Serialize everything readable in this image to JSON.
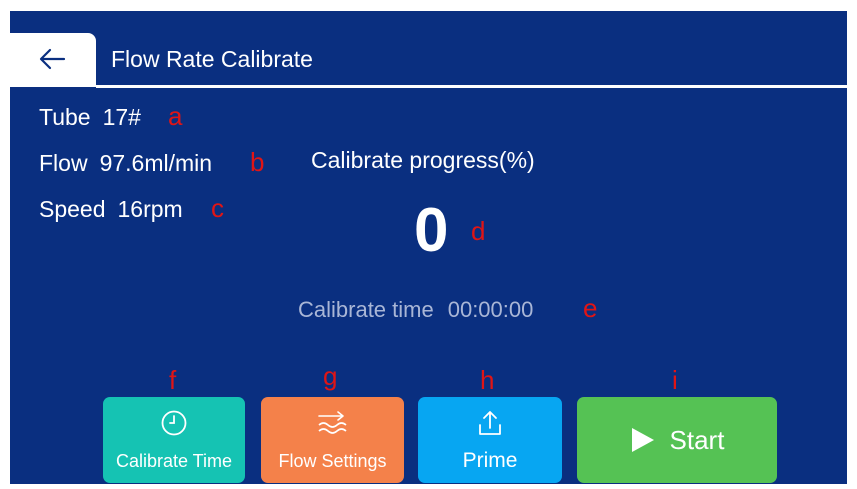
{
  "header": {
    "title": "Flow Rate Calibrate",
    "back_icon": "arrow-left-icon"
  },
  "info": {
    "tube_label": "Tube",
    "tube_value": "17#",
    "flow_label": "Flow",
    "flow_value": "97.6ml/min",
    "speed_label": "Speed",
    "speed_value": "16rpm"
  },
  "progress": {
    "title": "Calibrate progress(%)",
    "value": "0"
  },
  "calibrate_time": {
    "label": "Calibrate time",
    "value": "00:00:00"
  },
  "markers": {
    "a": "a",
    "b": "b",
    "c": "c",
    "d": "d",
    "e": "e",
    "f": "f",
    "g": "g",
    "h": "h",
    "i": "i"
  },
  "buttons": {
    "calibrate_time": {
      "label": "Calibrate Time",
      "icon": "clock-icon",
      "color": "#15c3b3"
    },
    "flow_settings": {
      "label": "Flow Settings",
      "icon": "waves-icon",
      "color": "#f4814a"
    },
    "prime": {
      "label": "Prime",
      "icon": "upload-icon",
      "color": "#07a6f2"
    },
    "start": {
      "label": "Start",
      "icon": "play-icon",
      "color": "#55c254"
    }
  },
  "colors": {
    "background": "#0a2f80",
    "marker": "#e01515"
  }
}
